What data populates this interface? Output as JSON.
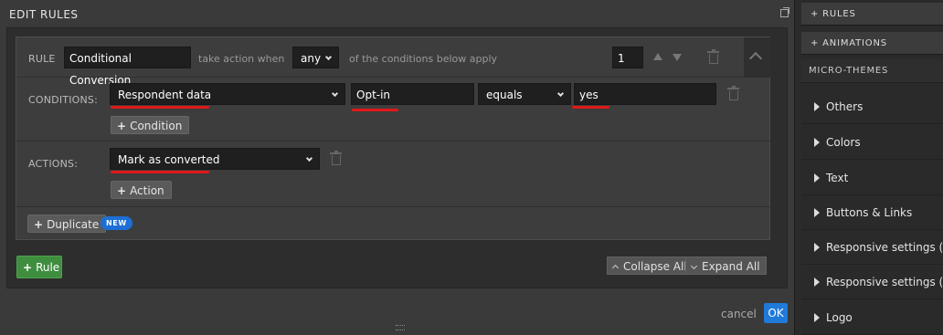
{
  "modal": {
    "title": "EDIT RULES",
    "rule": {
      "label": "RULE",
      "name": "Conditional Conversion",
      "take_action_text": "take action when",
      "match_mode": "any",
      "conditions_suffix": "of the conditions below apply",
      "order": "1"
    },
    "conditions": {
      "label": "CONDITIONS:",
      "source": "Respondent data",
      "field": "Opt-in",
      "operator": "equals",
      "value": "yes",
      "add_label": "Condition"
    },
    "actions": {
      "label": "ACTIONS:",
      "action": "Mark as converted",
      "add_label": "Action"
    },
    "duplicate_label": "Duplicate",
    "new_badge": "NEW",
    "add_rule_label": "Rule",
    "collapse_all": "Collapse All",
    "expand_all": "Expand All",
    "cancel_label": "cancel",
    "ok_label": "OK"
  },
  "right_panel": {
    "rules_bar": "+ RULES",
    "animations_bar": "+ ANIMATIONS",
    "micro_themes_header": "MICRO-THEMES",
    "items": [
      "Others",
      "Colors",
      "Text",
      "Buttons & Links",
      "Responsive settings (SM",
      "Responsive settings (XS",
      "Logo"
    ]
  },
  "colors": {
    "annotation_underline": "#e01818",
    "ok_blue": "#1f7ad8",
    "add_rule_green": "#3f8e3f",
    "new_badge_blue": "#1d6fd6"
  }
}
